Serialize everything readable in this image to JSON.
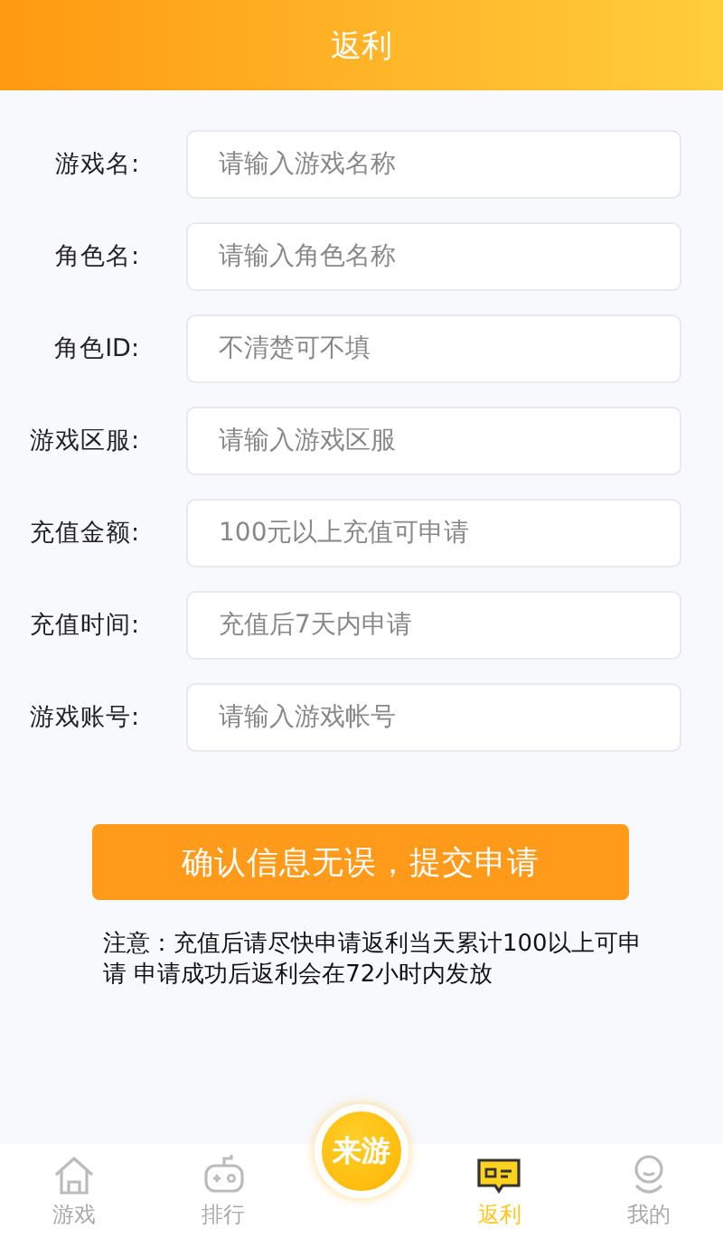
{
  "header": {
    "title": "返利"
  },
  "form": [
    {
      "label": "游戏名:",
      "placeholder": "请输入游戏名称"
    },
    {
      "label": "角色名:",
      "placeholder": "请输入角色名称"
    },
    {
      "label": "角色ID:",
      "placeholder": "不清楚可不填"
    },
    {
      "label": "游戏区服:",
      "placeholder": "请输入游戏区服"
    },
    {
      "label": "充值金额:",
      "placeholder": "100元以上充值可申请"
    },
    {
      "label": "充值时间:",
      "placeholder": "充值后7天内申请"
    },
    {
      "label": "游戏账号:",
      "placeholder": "请输入游戏帐号"
    }
  ],
  "submit": "确认信息无误，提交申请",
  "note": "注意：充值后请尽快申请返利当天累计100以上可申请 申请成功后返利会在72小时内发放",
  "tabs": [
    {
      "kind": "home",
      "label": "游戏",
      "selected": false
    },
    {
      "kind": "gamepad",
      "label": "排行",
      "selected": false
    },
    {
      "kind": "logo",
      "label": "来游",
      "selected": false
    },
    {
      "kind": "ticket",
      "label": "返利",
      "selected": true
    },
    {
      "kind": "person",
      "label": "我的",
      "selected": false
    }
  ]
}
